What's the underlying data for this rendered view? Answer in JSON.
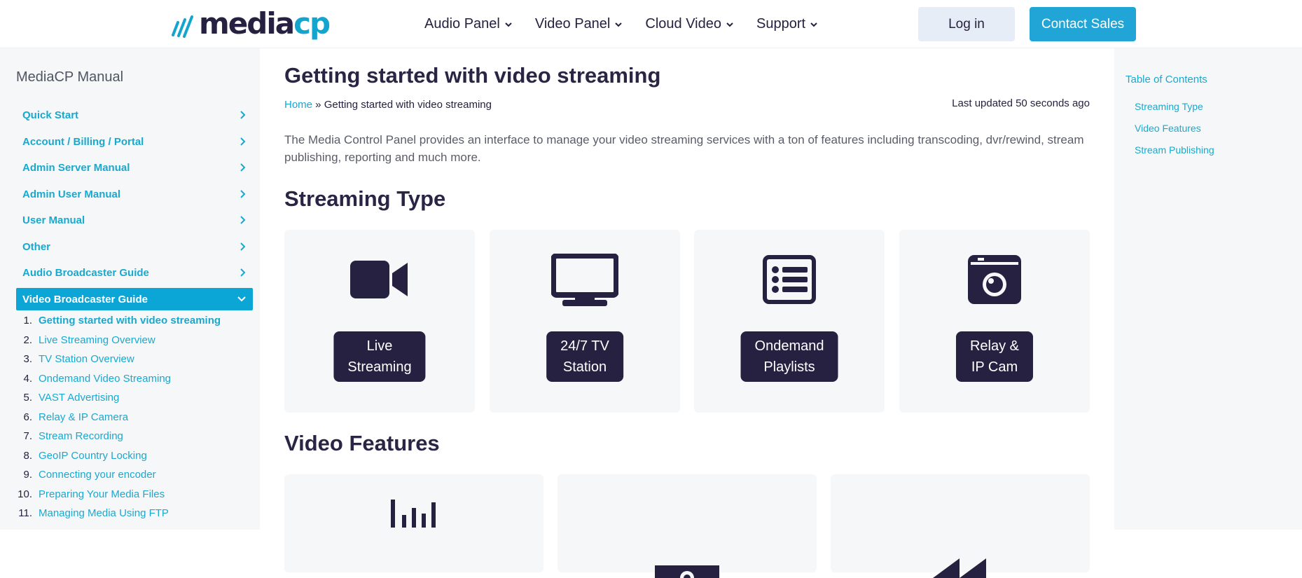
{
  "header": {
    "logo": {
      "part1": "media",
      "part2": "cp"
    },
    "nav": [
      "Audio Panel",
      "Video Panel",
      "Cloud Video",
      "Support"
    ],
    "login_label": "Log in",
    "contact_label": "Contact Sales"
  },
  "sidebar": {
    "title": "MediaCP Manual",
    "items": [
      {
        "label": "Quick Start"
      },
      {
        "label": "Account / Billing / Portal"
      },
      {
        "label": "Admin Server Manual"
      },
      {
        "label": "Admin User Manual"
      },
      {
        "label": "User Manual"
      },
      {
        "label": "Other"
      },
      {
        "label": "Audio Broadcaster Guide"
      },
      {
        "label": "Video Broadcaster Guide"
      }
    ],
    "subitems": [
      {
        "num": "1.",
        "label": "Getting started with video streaming"
      },
      {
        "num": "2.",
        "label": "Live Streaming Overview"
      },
      {
        "num": "3.",
        "label": "TV Station Overview"
      },
      {
        "num": "4.",
        "label": "Ondemand Video Streaming"
      },
      {
        "num": "5.",
        "label": "VAST Advertising"
      },
      {
        "num": "6.",
        "label": "Relay & IP Camera"
      },
      {
        "num": "7.",
        "label": "Stream Recording"
      },
      {
        "num": "8.",
        "label": "GeoIP Country Locking"
      },
      {
        "num": "9.",
        "label": "Connecting your encoder"
      },
      {
        "num": "10.",
        "label": "Preparing Your Media Files"
      },
      {
        "num": "11.",
        "label": "Managing Media Using FTP"
      }
    ]
  },
  "main": {
    "title": "Getting started with video streaming",
    "breadcrumb": {
      "home": "Home",
      "sep": " » ",
      "current": "Getting started with video streaming"
    },
    "updated": "Last updated 50 seconds ago",
    "intro": "The Media Control Panel provides an interface to manage your video streaming services with a ton of features including transcoding, dvr/rewind, stream publishing, reporting and much more.",
    "streaming_type_heading": "Streaming Type",
    "streaming_cards": [
      {
        "line1": "Live",
        "line2": "Streaming",
        "icon": "video-camera-icon"
      },
      {
        "line1": "24/7 TV",
        "line2": "Station",
        "icon": "tv-icon"
      },
      {
        "line1": "Ondemand",
        "line2": "Playlists",
        "icon": "list-icon"
      },
      {
        "line1": "Relay &",
        "line2": "IP Cam",
        "icon": "camera-icon"
      }
    ],
    "video_features_heading": "Video Features",
    "feature_cards": [
      {
        "icon": "chart-bars-icon"
      },
      {
        "icon": "money-icon"
      },
      {
        "icon": "rewind-icon"
      }
    ]
  },
  "toc": {
    "title": "Table of Contents",
    "items": [
      "Streaming Type",
      "Video Features",
      "Stream Publishing"
    ]
  },
  "colors": {
    "accent": "#0ba6d6",
    "dark": "#262140",
    "panel": "#f6f7f8"
  }
}
